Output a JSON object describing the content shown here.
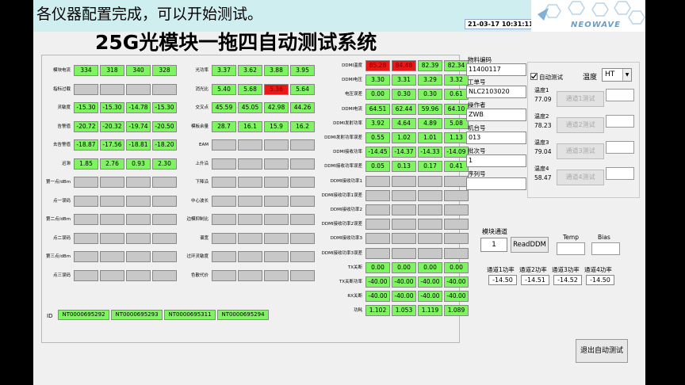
{
  "status_message": "各仪器配置完成，可以开始测试。",
  "datetime": "21-03-17 10:31:11",
  "logo_text": "NEOWAVE",
  "main_title": "25G光模块一拖四自动测试系统",
  "colors": {
    "pass": "#7ef560",
    "fail": "#e81818",
    "empty": "#c8c8c8",
    "topbar": "#cfeef0"
  },
  "group1": {
    "labels": [
      "模块电流",
      "指标过载",
      "灵敏度",
      "告警值",
      "去告警值",
      "迟滞",
      "第一点/dBm",
      "点一误码",
      "第二点/dBm",
      "点二误码",
      "第三点/dBm",
      "点三误码"
    ],
    "rows": [
      [
        {
          "v": "334",
          "s": "g"
        },
        {
          "v": "318",
          "s": "g"
        },
        {
          "v": "340",
          "s": "g"
        },
        {
          "v": "328",
          "s": "g"
        }
      ],
      [
        {
          "v": "",
          "s": "e"
        },
        {
          "v": "",
          "s": "e"
        },
        {
          "v": "",
          "s": "e"
        },
        {
          "v": "",
          "s": "e"
        }
      ],
      [
        {
          "v": "-15.30",
          "s": "g"
        },
        {
          "v": "-15.30",
          "s": "g"
        },
        {
          "v": "-14.78",
          "s": "g"
        },
        {
          "v": "-15.30",
          "s": "g"
        }
      ],
      [
        {
          "v": "-20.72",
          "s": "g"
        },
        {
          "v": "-20.32",
          "s": "g"
        },
        {
          "v": "-19.74",
          "s": "g"
        },
        {
          "v": "-20.50",
          "s": "g"
        }
      ],
      [
        {
          "v": "-18.87",
          "s": "g"
        },
        {
          "v": "-17.56",
          "s": "g"
        },
        {
          "v": "-18.81",
          "s": "g"
        },
        {
          "v": "-18.20",
          "s": "g"
        }
      ],
      [
        {
          "v": "1.85",
          "s": "g"
        },
        {
          "v": "2.76",
          "s": "g"
        },
        {
          "v": "0.93",
          "s": "g"
        },
        {
          "v": "2.30",
          "s": "g"
        }
      ],
      [
        {
          "v": "",
          "s": "e"
        },
        {
          "v": "",
          "s": "e"
        },
        {
          "v": "",
          "s": "e"
        },
        {
          "v": "",
          "s": "e"
        }
      ],
      [
        {
          "v": "",
          "s": "e"
        },
        {
          "v": "",
          "s": "e"
        },
        {
          "v": "",
          "s": "e"
        },
        {
          "v": "",
          "s": "e"
        }
      ],
      [
        {
          "v": "",
          "s": "e"
        },
        {
          "v": "",
          "s": "e"
        },
        {
          "v": "",
          "s": "e"
        },
        {
          "v": "",
          "s": "e"
        }
      ],
      [
        {
          "v": "",
          "s": "e"
        },
        {
          "v": "",
          "s": "e"
        },
        {
          "v": "",
          "s": "e"
        },
        {
          "v": "",
          "s": "e"
        }
      ],
      [
        {
          "v": "",
          "s": "e"
        },
        {
          "v": "",
          "s": "e"
        },
        {
          "v": "",
          "s": "e"
        },
        {
          "v": "",
          "s": "e"
        }
      ],
      [
        {
          "v": "",
          "s": "e"
        },
        {
          "v": "",
          "s": "e"
        },
        {
          "v": "",
          "s": "e"
        },
        {
          "v": "",
          "s": "e"
        }
      ]
    ]
  },
  "group2": {
    "labels": [
      "光功率",
      "消光比",
      "交叉点",
      "模板余量",
      "EAM",
      "上升沿",
      "下降沿",
      "中心波长",
      "边模抑制比",
      "谱宽",
      "过环灵敏度",
      "色散代价"
    ],
    "rows": [
      [
        {
          "v": "3.37",
          "s": "g"
        },
        {
          "v": "3.62",
          "s": "g"
        },
        {
          "v": "3.88",
          "s": "g"
        },
        {
          "v": "3.95",
          "s": "g"
        }
      ],
      [
        {
          "v": "5.40",
          "s": "g"
        },
        {
          "v": "5.68",
          "s": "g"
        },
        {
          "v": "5.36",
          "s": "r"
        },
        {
          "v": "5.64",
          "s": "g"
        }
      ],
      [
        {
          "v": "45.59",
          "s": "g"
        },
        {
          "v": "45.05",
          "s": "g"
        },
        {
          "v": "42.98",
          "s": "g"
        },
        {
          "v": "44.26",
          "s": "g"
        }
      ],
      [
        {
          "v": "28.7",
          "s": "g"
        },
        {
          "v": "16.1",
          "s": "g"
        },
        {
          "v": "15.9",
          "s": "g"
        },
        {
          "v": "16.2",
          "s": "g"
        }
      ],
      [
        {
          "v": "",
          "s": "e"
        },
        {
          "v": "",
          "s": "e"
        },
        {
          "v": "",
          "s": "e"
        },
        {
          "v": "",
          "s": "e"
        }
      ],
      [
        {
          "v": "",
          "s": "e"
        },
        {
          "v": "",
          "s": "e"
        },
        {
          "v": "",
          "s": "e"
        },
        {
          "v": "",
          "s": "e"
        }
      ],
      [
        {
          "v": "",
          "s": "e"
        },
        {
          "v": "",
          "s": "e"
        },
        {
          "v": "",
          "s": "e"
        },
        {
          "v": "",
          "s": "e"
        }
      ],
      [
        {
          "v": "",
          "s": "e"
        },
        {
          "v": "",
          "s": "e"
        },
        {
          "v": "",
          "s": "e"
        },
        {
          "v": "",
          "s": "e"
        }
      ],
      [
        {
          "v": "",
          "s": "e"
        },
        {
          "v": "",
          "s": "e"
        },
        {
          "v": "",
          "s": "e"
        },
        {
          "v": "",
          "s": "e"
        }
      ],
      [
        {
          "v": "",
          "s": "e"
        },
        {
          "v": "",
          "s": "e"
        },
        {
          "v": "",
          "s": "e"
        },
        {
          "v": "",
          "s": "e"
        }
      ],
      [
        {
          "v": "",
          "s": "e"
        },
        {
          "v": "",
          "s": "e"
        },
        {
          "v": "",
          "s": "e"
        },
        {
          "v": "",
          "s": "e"
        }
      ],
      [
        {
          "v": "",
          "s": "e"
        },
        {
          "v": "",
          "s": "e"
        },
        {
          "v": "",
          "s": "e"
        },
        {
          "v": "",
          "s": "e"
        }
      ]
    ]
  },
  "group3": {
    "labels": [
      "DDMI温度",
      "DDMI电压",
      "电压误差",
      "DDMI电流",
      "DDMI发射功率",
      "DDMI发射功率误差",
      "DDMI接收功率",
      "DDMI接收功率误差",
      "DDMI接收功率1",
      "DDMI接收功率1误差",
      "DDMI接收功率2",
      "DDMI接收功率2误差",
      "DDMI接收功率3",
      "DDMI接收功率3误差",
      "TX关断",
      "TX关断功率",
      "RX关断",
      "功耗"
    ],
    "rows": [
      [
        {
          "v": "85.28",
          "s": "r"
        },
        {
          "v": "84.48",
          "s": "r"
        },
        {
          "v": "82.39",
          "s": "g"
        },
        {
          "v": "82.34",
          "s": "g"
        }
      ],
      [
        {
          "v": "3.30",
          "s": "g"
        },
        {
          "v": "3.31",
          "s": "g"
        },
        {
          "v": "3.29",
          "s": "g"
        },
        {
          "v": "3.32",
          "s": "g"
        }
      ],
      [
        {
          "v": "0.00",
          "s": "g"
        },
        {
          "v": "0.30",
          "s": "g"
        },
        {
          "v": "0.30",
          "s": "g"
        },
        {
          "v": "0.61",
          "s": "g"
        }
      ],
      [
        {
          "v": "64.51",
          "s": "g"
        },
        {
          "v": "62.44",
          "s": "g"
        },
        {
          "v": "59.96",
          "s": "g"
        },
        {
          "v": "64.10",
          "s": "g"
        }
      ],
      [
        {
          "v": "3.92",
          "s": "g"
        },
        {
          "v": "4.64",
          "s": "g"
        },
        {
          "v": "4.89",
          "s": "g"
        },
        {
          "v": "5.08",
          "s": "g"
        }
      ],
      [
        {
          "v": "0.55",
          "s": "g"
        },
        {
          "v": "1.02",
          "s": "g"
        },
        {
          "v": "1.01",
          "s": "g"
        },
        {
          "v": "1.13",
          "s": "g"
        }
      ],
      [
        {
          "v": "-14.45",
          "s": "g"
        },
        {
          "v": "-14.37",
          "s": "g"
        },
        {
          "v": "-14.33",
          "s": "g"
        },
        {
          "v": "-14.09",
          "s": "g"
        }
      ],
      [
        {
          "v": "0.05",
          "s": "g"
        },
        {
          "v": "0.13",
          "s": "g"
        },
        {
          "v": "0.17",
          "s": "g"
        },
        {
          "v": "0.41",
          "s": "g"
        }
      ],
      [
        {
          "v": "",
          "s": "e"
        },
        {
          "v": "",
          "s": "e"
        },
        {
          "v": "",
          "s": "e"
        },
        {
          "v": "",
          "s": "e"
        }
      ],
      [
        {
          "v": "",
          "s": "e"
        },
        {
          "v": "",
          "s": "e"
        },
        {
          "v": "",
          "s": "e"
        },
        {
          "v": "",
          "s": "e"
        }
      ],
      [
        {
          "v": "",
          "s": "e"
        },
        {
          "v": "",
          "s": "e"
        },
        {
          "v": "",
          "s": "e"
        },
        {
          "v": "",
          "s": "e"
        }
      ],
      [
        {
          "v": "",
          "s": "e"
        },
        {
          "v": "",
          "s": "e"
        },
        {
          "v": "",
          "s": "e"
        },
        {
          "v": "",
          "s": "e"
        }
      ],
      [
        {
          "v": "",
          "s": "e"
        },
        {
          "v": "",
          "s": "e"
        },
        {
          "v": "",
          "s": "e"
        },
        {
          "v": "",
          "s": "e"
        }
      ],
      [
        {
          "v": "",
          "s": "e"
        },
        {
          "v": "",
          "s": "e"
        },
        {
          "v": "",
          "s": "e"
        },
        {
          "v": "",
          "s": "e"
        }
      ],
      [
        {
          "v": "0.00",
          "s": "g"
        },
        {
          "v": "0.00",
          "s": "g"
        },
        {
          "v": "0.00",
          "s": "g"
        },
        {
          "v": "0.00",
          "s": "g"
        }
      ],
      [
        {
          "v": "-40.00",
          "s": "g"
        },
        {
          "v": "-40.00",
          "s": "g"
        },
        {
          "v": "-40.00",
          "s": "g"
        },
        {
          "v": "-40.00",
          "s": "g"
        }
      ],
      [
        {
          "v": "-40.00",
          "s": "g"
        },
        {
          "v": "-40.00",
          "s": "g"
        },
        {
          "v": "-40.00",
          "s": "g"
        },
        {
          "v": "-40.00",
          "s": "g"
        }
      ],
      [
        {
          "v": "1.102",
          "s": "g"
        },
        {
          "v": "1.053",
          "s": "g"
        },
        {
          "v": "1.119",
          "s": "g"
        },
        {
          "v": "1.089",
          "s": "g"
        }
      ]
    ]
  },
  "ids": {
    "label": "ID",
    "values": [
      "NT0000695292",
      "NT0000695293",
      "NT0000695311",
      "NT0000695294"
    ]
  },
  "info": {
    "material_code_label": "物料编码",
    "material_code": "11400117",
    "work_order_label": "工单号",
    "work_order": "NLC2103020",
    "operator_label": "操作者",
    "operator": "ZWB",
    "station_label": "机台号",
    "station": "013",
    "batch_label": "批次号",
    "batch": "1",
    "serial_label": "序列号",
    "serial": ""
  },
  "auto_test": {
    "label": "自动测试",
    "checked": true
  },
  "temperature": {
    "label": "温度",
    "value": "HT"
  },
  "channels": [
    {
      "temp_label": "温度1",
      "temp": "77.09",
      "button": "通道1测试"
    },
    {
      "temp_label": "温度2",
      "temp": "78.23",
      "button": "通道2测试"
    },
    {
      "temp_label": "温度3",
      "temp": "79.04",
      "button": "通道3测试"
    },
    {
      "temp_label": "温度4",
      "temp": "58.47",
      "button": "通道4测试"
    }
  ],
  "module_channel": {
    "label": "模块通道",
    "value": "1"
  },
  "read_ddm_button": "ReadDDM",
  "temp_label": "Temp",
  "bias_label": "Bias",
  "power": [
    {
      "label": "通道1功率",
      "value": "-14.50"
    },
    {
      "label": "通道2功率",
      "value": "-14.51"
    },
    {
      "label": "通道3功率",
      "value": "-14.52"
    },
    {
      "label": "通道4功率",
      "value": "-14.50"
    }
  ],
  "exit_button": "退出自动测试"
}
